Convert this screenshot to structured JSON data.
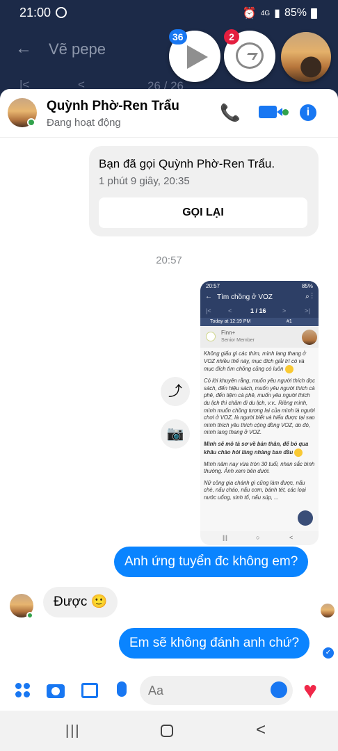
{
  "status_bar": {
    "time": "21:00",
    "network": "4G",
    "battery": "85%"
  },
  "background_app": {
    "title": "Vẽ pepe",
    "page_indicator": "26 / 26"
  },
  "chat_heads": {
    "video_badge": "36",
    "messenger_badge": "2"
  },
  "header": {
    "name": "Quỳnh Phờ-Ren Trẩu",
    "status": "Đang hoạt động"
  },
  "call_card": {
    "title": "Bạn đã gọi Quỳnh Phờ-Ren Trẩu.",
    "duration": "1 phút 9 giây, 20:35",
    "callback_label": "GỌI LẠI"
  },
  "timestamp": "20:57",
  "screenshot": {
    "status_time": "20:57",
    "status_battery": "85%",
    "title": "Tìm chồng ở VOZ",
    "page": "1 / 16",
    "post_time": "Today at 12:19 PM",
    "post_number": "#1",
    "username": "Finn+",
    "rank": "Senior Member",
    "p1": "Không giấu gì các thím, mình lang thang ở VOZ nhiều thế này, mục đích giải trí có và mục đích tìm chồng cũng có luôn",
    "p2": "Có lời khuyên rằng, muốn yêu người thích đọc sách, đến hiệu sách, muốn yêu người thích cà phê, đến tiệm cà phê, muốn yêu người thích du lịch thì chăm đi du lịch, v.v.. Riêng mình, mình muốn chồng tương lai của mình là người chơi ở VOZ, là người biết và hiểu được tại sao mình thích yêu thích cộng đồng VOZ, do đó, mình lang thang ở VOZ.",
    "p3": "Mình sẽ mô tả sơ về bản thân, để bỏ qua khâu chào hỏi làng nhàng ban đầu",
    "p4": "Mình năm nay vừa tròn 30 tuổi, nhan sắc bình thường. Ảnh xem bên dưới.",
    "p5": "Nữ công gia chánh gì cũng làm được, nấu chè, nấu cháo, nấu cơm, bánh tét, các loại nước uống, sinh tố, nấu súp, ..."
  },
  "messages": [
    {
      "direction": "out",
      "text": "Anh ứng tuyển đc không em?"
    },
    {
      "direction": "in",
      "text": "Được 🙂"
    },
    {
      "direction": "out",
      "text": "Em sẽ không đánh anh chứ?"
    }
  ],
  "composer": {
    "placeholder": "Aa"
  },
  "colors": {
    "accent": "#1877f2",
    "bubble_out": "#0a84ff",
    "heart": "#f02849"
  }
}
